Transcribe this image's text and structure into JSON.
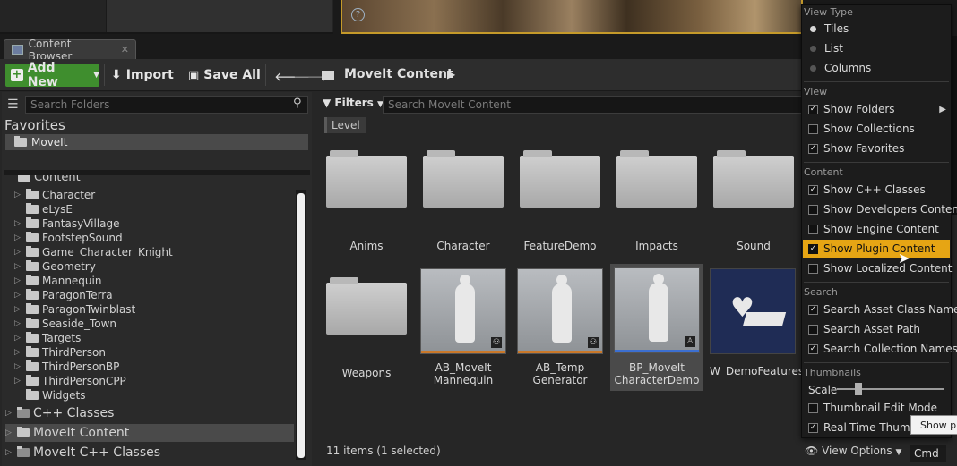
{
  "tab": {
    "label": "Content Browser"
  },
  "toolbar": {
    "add_new": "Add New",
    "import": "Import",
    "save_all": "Save All",
    "path": "MoveIt Content"
  },
  "left": {
    "search_placeholder": "Search Folders",
    "favorites_header": "Favorites",
    "favorites": [
      "MoveIt"
    ],
    "tree_partial": "Content",
    "tree": [
      "Character",
      "eLysE",
      "FantasyVillage",
      "FootstepSound",
      "Game_Character_Knight",
      "Geometry",
      "Mannequin",
      "ParagonTerra",
      "ParagonTwinblast",
      "Seaside_Town",
      "Targets",
      "ThirdPerson",
      "ThirdPersonBP",
      "ThirdPersonCPP",
      "Widgets"
    ],
    "roots": [
      "C++ Classes",
      "MoveIt Content",
      "MoveIt C++ Classes"
    ]
  },
  "right": {
    "filters": "Filters",
    "search_placeholder": "Search MoveIt Content",
    "level_chip": "Level",
    "folders": [
      "Anims",
      "Character",
      "FeatureDemo",
      "Impacts",
      "Sound",
      "Weapons"
    ],
    "assets": [
      {
        "line1": "AB_MoveIt",
        "line2": "Mannequin"
      },
      {
        "line1": "AB_Temp",
        "line2": "Generator"
      },
      {
        "line1": "BP_MoveIt",
        "line2": "CharacterDemo"
      },
      {
        "line1": "W_DemoFeatures",
        "line2": ""
      }
    ],
    "status": "11 items (1 selected)",
    "view_options": "View Options",
    "cmd": "Cmd"
  },
  "menu": {
    "view_type_header": "View Type",
    "view_types": [
      "Tiles",
      "List",
      "Columns"
    ],
    "view_header": "View",
    "view_items": [
      {
        "label": "Show Folders",
        "checked": true
      },
      {
        "label": "Show Collections",
        "checked": false
      },
      {
        "label": "Show Favorites",
        "checked": true
      }
    ],
    "content_header": "Content",
    "content_items": [
      {
        "label": "Show C++ Classes",
        "checked": true
      },
      {
        "label": "Show Developers Content",
        "checked": false
      },
      {
        "label": "Show Engine Content",
        "checked": false
      },
      {
        "label": "Show Plugin Content",
        "checked": true
      },
      {
        "label": "Show Localized Content",
        "checked": false
      }
    ],
    "search_header": "Search",
    "search_items": [
      {
        "label": "Search Asset Class Names",
        "checked": true
      },
      {
        "label": "Search Asset Path",
        "checked": false
      },
      {
        "label": "Search Collection Names",
        "checked": true
      }
    ],
    "thumbnails_header": "Thumbnails",
    "scale_label": "Scale",
    "scale_value": 0.2,
    "thumb_items": [
      {
        "label": "Thumbnail Edit Mode",
        "checked": false
      },
      {
        "label": "Real-Time Thumbnails",
        "checked": true
      }
    ]
  },
  "tooltip": "Show plugin content",
  "colors": {
    "accent": "#e6a514",
    "add_new": "#3f8e2e",
    "viewport_border": "#c59a2a"
  }
}
